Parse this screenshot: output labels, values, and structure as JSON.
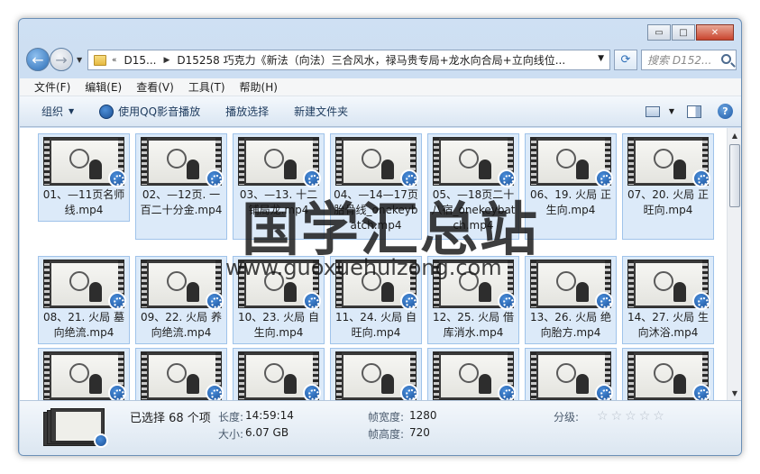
{
  "window": {
    "minimize_glyph": "▭",
    "maximize_glyph": "□",
    "close_glyph": "✕"
  },
  "address": {
    "overflow_glyph": "«",
    "crumbs": [
      "D15...",
      "D15258 巧克力《新法（向法）三合风水，禄马贵专局+龙水向合局+立向线位..."
    ],
    "search_placeholder": "搜索 D152..."
  },
  "menu": [
    "文件(F)",
    "编辑(E)",
    "查看(V)",
    "工具(T)",
    "帮助(H)"
  ],
  "toolbar": {
    "organize": "组织",
    "play_qq": "使用QQ影音播放",
    "play_select": "播放选择",
    "new_folder": "新建文件夹"
  },
  "files": [
    {
      "label": "01、—11页名师线.mp4"
    },
    {
      "label": "02、—12页. 一百二十分金.mp4"
    },
    {
      "label": "03、—13. 十二铺局龙.mp4"
    },
    {
      "label": "04、—14—17页胎骨线_onekeybatch.mp4"
    },
    {
      "label": "05、—18页二十八宿_onekeybatch.mp4"
    },
    {
      "label": "06、19. 火局 正生向.mp4"
    },
    {
      "label": "07、20. 火局 正旺向.mp4"
    },
    {
      "label": "08、21. 火局 墓向绝流.mp4"
    },
    {
      "label": "09、22. 火局 养向绝流.mp4"
    },
    {
      "label": "10、23. 火局 自生向.mp4"
    },
    {
      "label": "11、24. 火局 自旺向.mp4"
    },
    {
      "label": "12、25. 火局 借库消水.mp4"
    },
    {
      "label": "13、26. 火局 绝向胎方.mp4"
    },
    {
      "label": "14、27. 火局 生向沐浴.mp4"
    },
    {
      "label": ""
    },
    {
      "label": ""
    },
    {
      "label": ""
    },
    {
      "label": ""
    },
    {
      "label": ""
    },
    {
      "label": ""
    },
    {
      "label": ""
    }
  ],
  "status": {
    "selected": "已选择 68 个项",
    "length_label": "长度:",
    "length_value": "14:59:14",
    "size_label": "大小:",
    "size_value": "6.07 GB",
    "frame_width_label": "帧宽度:",
    "frame_width_value": "1280",
    "frame_height_label": "帧高度:",
    "frame_height_value": "720",
    "rating_label": "分级:",
    "star_glyph": "☆"
  },
  "watermark": {
    "cn": "国学汇总站",
    "url": "www.guoxuehuizong.com"
  }
}
